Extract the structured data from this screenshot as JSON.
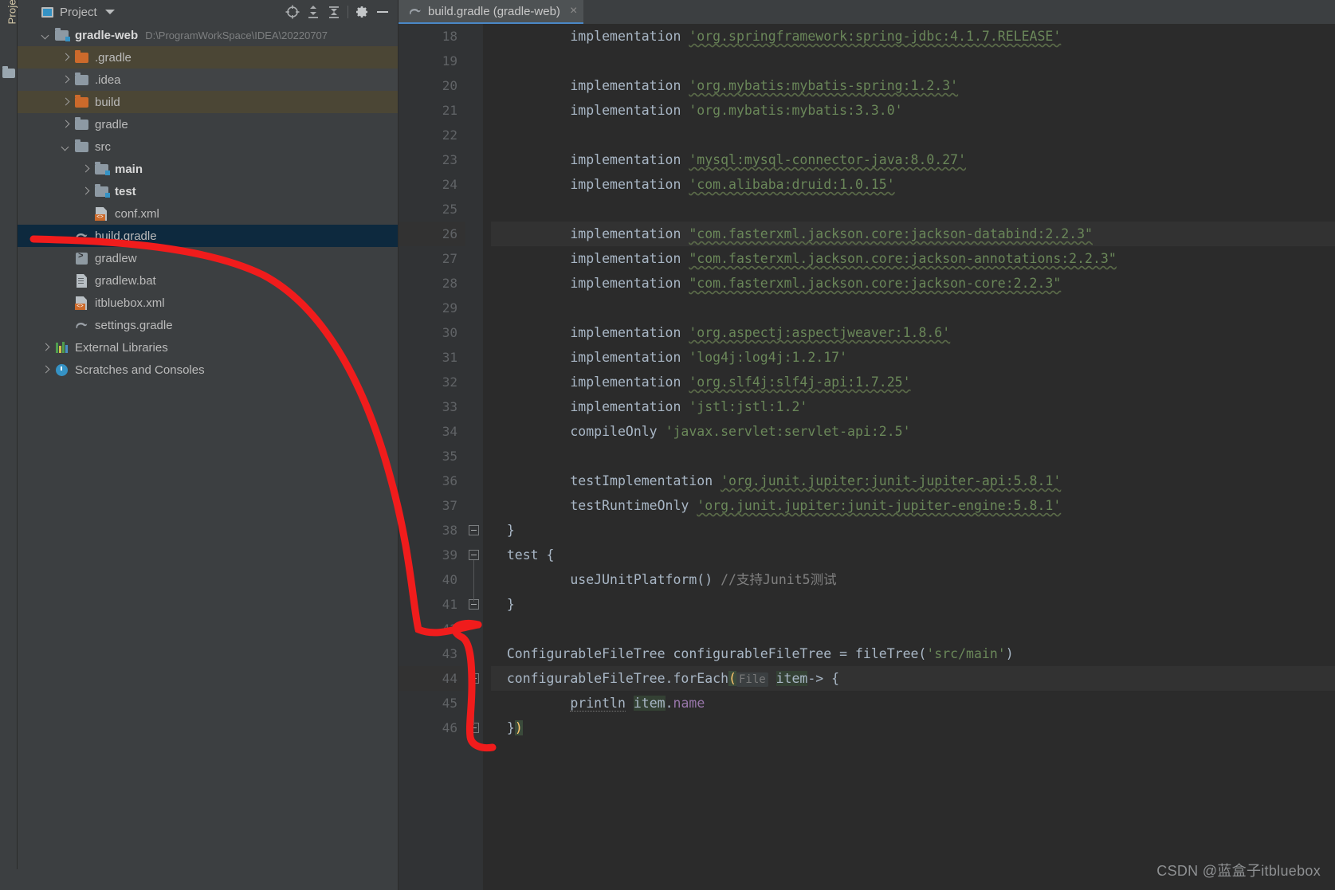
{
  "toolwindow": {
    "vertical_tab_label": "Project"
  },
  "panel": {
    "title": "Project",
    "icons": [
      {
        "name": "select-opened-file-icon",
        "label": "locate"
      },
      {
        "name": "expand-all-icon",
        "label": "expand-all"
      },
      {
        "name": "collapse-all-icon",
        "label": "collapse-all"
      },
      {
        "name": "gear-icon",
        "label": "settings"
      },
      {
        "name": "minimize-icon",
        "label": "hide"
      }
    ]
  },
  "tree": [
    {
      "depth": 0,
      "arrow": "down",
      "icon": "module-folder-icon",
      "label": "gradle-web",
      "bold": true,
      "path": "D:\\ProgramWorkSpace\\IDEA\\20220707",
      "row": "normal"
    },
    {
      "depth": 1,
      "arrow": "right",
      "icon": "folder-orange-icon",
      "label": ".gradle",
      "bold": false,
      "path": "",
      "row": "alt"
    },
    {
      "depth": 1,
      "arrow": "right",
      "icon": "folder-gray-icon",
      "label": ".idea",
      "bold": false,
      "path": "",
      "row": "dim"
    },
    {
      "depth": 1,
      "arrow": "right",
      "icon": "folder-orange-icon",
      "label": "build",
      "bold": false,
      "path": "",
      "row": "alt"
    },
    {
      "depth": 1,
      "arrow": "right",
      "icon": "folder-gray-icon",
      "label": "gradle",
      "bold": false,
      "path": "",
      "row": "normal"
    },
    {
      "depth": 1,
      "arrow": "down",
      "icon": "folder-gray-icon",
      "label": "src",
      "bold": false,
      "path": "",
      "row": "normal"
    },
    {
      "depth": 2,
      "arrow": "right",
      "icon": "source-folder-icon",
      "label": "main",
      "bold": true,
      "path": "",
      "row": "normal"
    },
    {
      "depth": 2,
      "arrow": "right",
      "icon": "test-folder-icon",
      "label": "test",
      "bold": true,
      "path": "",
      "row": "normal"
    },
    {
      "depth": 2,
      "arrow": "none",
      "icon": "xml-file-icon",
      "label": "conf.xml",
      "bold": false,
      "path": "",
      "row": "normal"
    },
    {
      "depth": 1,
      "arrow": "none",
      "icon": "gradle-file-icon",
      "label": "build.gradle",
      "bold": false,
      "path": "",
      "row": "sel"
    },
    {
      "depth": 1,
      "arrow": "none",
      "icon": "shell-file-icon",
      "label": "gradlew",
      "bold": false,
      "path": "",
      "row": "normal"
    },
    {
      "depth": 1,
      "arrow": "none",
      "icon": "bat-file-icon",
      "label": "gradlew.bat",
      "bold": false,
      "path": "",
      "row": "normal"
    },
    {
      "depth": 1,
      "arrow": "none",
      "icon": "xml-file-icon",
      "label": "itbluebox.xml",
      "bold": false,
      "path": "",
      "row": "normal"
    },
    {
      "depth": 1,
      "arrow": "none",
      "icon": "gradle-file-icon",
      "label": "settings.gradle",
      "bold": false,
      "path": "",
      "row": "normal"
    },
    {
      "depth": 0,
      "arrow": "right",
      "icon": "libraries-icon",
      "label": "External Libraries",
      "bold": false,
      "path": "",
      "row": "normal"
    },
    {
      "depth": 0,
      "arrow": "right",
      "icon": "scratches-icon",
      "label": "Scratches and Consoles",
      "bold": false,
      "path": "",
      "row": "normal"
    }
  ],
  "editor": {
    "tab": {
      "label": "build.gradle (gradle-web)",
      "icon": "gradle-file-icon",
      "close": "×"
    },
    "first_line_number": 18,
    "lines": [
      {
        "n": 18,
        "indent": 4,
        "tokens": [
          {
            "t": "kw",
            "v": "implementation"
          },
          {
            "t": "sp",
            "v": " "
          },
          {
            "t": "str-u",
            "v": "'org.springframework:spring-jdbc:4.1.7.RELEASE'"
          }
        ]
      },
      {
        "n": 19,
        "indent": 0,
        "tokens": []
      },
      {
        "n": 20,
        "indent": 4,
        "tokens": [
          {
            "t": "kw",
            "v": "implementation"
          },
          {
            "t": "sp",
            "v": " "
          },
          {
            "t": "str-u",
            "v": "'org.mybatis:mybatis-spring:1.2.3'"
          }
        ]
      },
      {
        "n": 21,
        "indent": 4,
        "tokens": [
          {
            "t": "kw",
            "v": "implementation"
          },
          {
            "t": "sp",
            "v": " "
          },
          {
            "t": "str",
            "v": "'org.mybatis:mybatis:3.3.0'"
          }
        ]
      },
      {
        "n": 22,
        "indent": 0,
        "tokens": []
      },
      {
        "n": 23,
        "indent": 4,
        "tokens": [
          {
            "t": "kw",
            "v": "implementation"
          },
          {
            "t": "sp",
            "v": " "
          },
          {
            "t": "str-u",
            "v": "'mysql:mysql-connector-java:8.0.27'"
          }
        ]
      },
      {
        "n": 24,
        "indent": 4,
        "tokens": [
          {
            "t": "kw",
            "v": "implementation"
          },
          {
            "t": "sp",
            "v": " "
          },
          {
            "t": "str-u",
            "v": "'com.alibaba:druid:1.0.15'"
          }
        ]
      },
      {
        "n": 25,
        "indent": 0,
        "tokens": []
      },
      {
        "n": 26,
        "indent": 4,
        "cur": true,
        "tokens": [
          {
            "t": "kw",
            "v": "implementation"
          },
          {
            "t": "sp",
            "v": " "
          },
          {
            "t": "str-u",
            "v": "\"com.fasterxml.jackson.core:jackson-databind:2.2.3\""
          }
        ]
      },
      {
        "n": 27,
        "indent": 4,
        "tokens": [
          {
            "t": "kw",
            "v": "implementation"
          },
          {
            "t": "sp",
            "v": " "
          },
          {
            "t": "str-u",
            "v": "\"com.fasterxml.jackson.core:jackson-annotations:2.2.3\""
          }
        ]
      },
      {
        "n": 28,
        "indent": 4,
        "tokens": [
          {
            "t": "kw",
            "v": "implementation"
          },
          {
            "t": "sp",
            "v": " "
          },
          {
            "t": "str-u",
            "v": "\"com.fasterxml.jackson.core:jackson-core:2.2.3\""
          }
        ]
      },
      {
        "n": 29,
        "indent": 0,
        "tokens": []
      },
      {
        "n": 30,
        "indent": 4,
        "tokens": [
          {
            "t": "kw",
            "v": "implementation"
          },
          {
            "t": "sp",
            "v": " "
          },
          {
            "t": "str-u",
            "v": "'org.aspectj:aspectjweaver:1.8.6'"
          }
        ]
      },
      {
        "n": 31,
        "indent": 4,
        "tokens": [
          {
            "t": "kw",
            "v": "implementation"
          },
          {
            "t": "sp",
            "v": " "
          },
          {
            "t": "str",
            "v": "'log4j:log4j:1.2.17'"
          }
        ]
      },
      {
        "n": 32,
        "indent": 4,
        "tokens": [
          {
            "t": "kw",
            "v": "implementation"
          },
          {
            "t": "sp",
            "v": " "
          },
          {
            "t": "str-u",
            "v": "'org.slf4j:slf4j-api:1.7.25'"
          }
        ]
      },
      {
        "n": 33,
        "indent": 4,
        "tokens": [
          {
            "t": "kw",
            "v": "implementation"
          },
          {
            "t": "sp",
            "v": " "
          },
          {
            "t": "str",
            "v": "'jstl:jstl:1.2'"
          }
        ]
      },
      {
        "n": 34,
        "indent": 4,
        "tokens": [
          {
            "t": "kw",
            "v": "compileOnly"
          },
          {
            "t": "sp",
            "v": " "
          },
          {
            "t": "str",
            "v": "'javax.servlet:servlet-api:2.5'"
          }
        ]
      },
      {
        "n": 35,
        "indent": 0,
        "tokens": []
      },
      {
        "n": 36,
        "indent": 4,
        "tokens": [
          {
            "t": "kw",
            "v": "testImplementation"
          },
          {
            "t": "sp",
            "v": " "
          },
          {
            "t": "str-u",
            "v": "'org.junit.jupiter:junit-jupiter-api:5.8.1'"
          }
        ]
      },
      {
        "n": 37,
        "indent": 4,
        "tokens": [
          {
            "t": "kw",
            "v": "testRuntimeOnly"
          },
          {
            "t": "sp",
            "v": " "
          },
          {
            "t": "str-u",
            "v": "'org.junit.jupiter:junit-jupiter-engine:5.8.1'"
          }
        ]
      },
      {
        "n": 38,
        "indent": 0,
        "fold": "end",
        "tokens": [
          {
            "t": "kw",
            "v": "}"
          }
        ]
      },
      {
        "n": 39,
        "indent": 0,
        "run": true,
        "fold": "start",
        "tokens": [
          {
            "t": "kw",
            "v": "test {"
          }
        ]
      },
      {
        "n": 40,
        "indent": 4,
        "tokens": [
          {
            "t": "kw",
            "v": "useJUnitPlatform()"
          },
          {
            "t": "sp",
            "v": " "
          },
          {
            "t": "cmt",
            "v": "//支持Junit5测试"
          }
        ]
      },
      {
        "n": 41,
        "indent": 0,
        "fold": "end",
        "tokens": [
          {
            "t": "kw",
            "v": "}"
          }
        ]
      },
      {
        "n": 42,
        "indent": 0,
        "tokens": []
      },
      {
        "n": 43,
        "indent": 0,
        "tokens": [
          {
            "t": "kw",
            "v": "ConfigurableFileTree configurableFileTree = fileTree("
          },
          {
            "t": "str",
            "v": "'src/main'"
          },
          {
            "t": "kw",
            "v": ")"
          }
        ]
      },
      {
        "n": 44,
        "indent": 0,
        "cur": true,
        "fold": "start",
        "tokens": [
          {
            "t": "kw",
            "v": "configurableFileTree.forEach"
          },
          {
            "t": "paren",
            "v": "("
          },
          {
            "t": "hint",
            "v": "File"
          },
          {
            "t": "sp",
            "v": " "
          },
          {
            "t": "item",
            "v": "item"
          },
          {
            "t": "kw",
            "v": "-> {"
          }
        ]
      },
      {
        "n": 45,
        "indent": 4,
        "tokens": [
          {
            "t": "dotted",
            "v": "println"
          },
          {
            "t": "sp",
            "v": " "
          },
          {
            "t": "item",
            "v": "item"
          },
          {
            "t": "kw",
            "v": "."
          },
          {
            "t": "prop",
            "v": "name"
          }
        ]
      },
      {
        "n": 46,
        "indent": 0,
        "fold": "end",
        "tokens": [
          {
            "t": "kw",
            "v": "}"
          },
          {
            "t": "paren",
            "v": ")"
          }
        ]
      }
    ]
  },
  "annotation": {
    "name": "red-marker-annotation",
    "color": "#f01c1c",
    "description": "hand drawn red arc from build.gradle in the tree to line 42/46 of the code"
  },
  "watermark": {
    "text": "CSDN @蓝盒子itbluebox"
  },
  "colors": {
    "panel_bg": "#3c3f41",
    "editor_bg": "#2b2b2b",
    "gutter_bg": "#313335",
    "selection": "#0d293e",
    "alt_row": "#4b4635",
    "string_green": "#6a8759",
    "code_fg": "#a9b7c6",
    "comment_gray": "#808080",
    "accent_blue": "#3592c4",
    "tab_active": "#4e5254",
    "tab_underline": "#4a88c7",
    "annotation_red": "#f01c1c"
  }
}
